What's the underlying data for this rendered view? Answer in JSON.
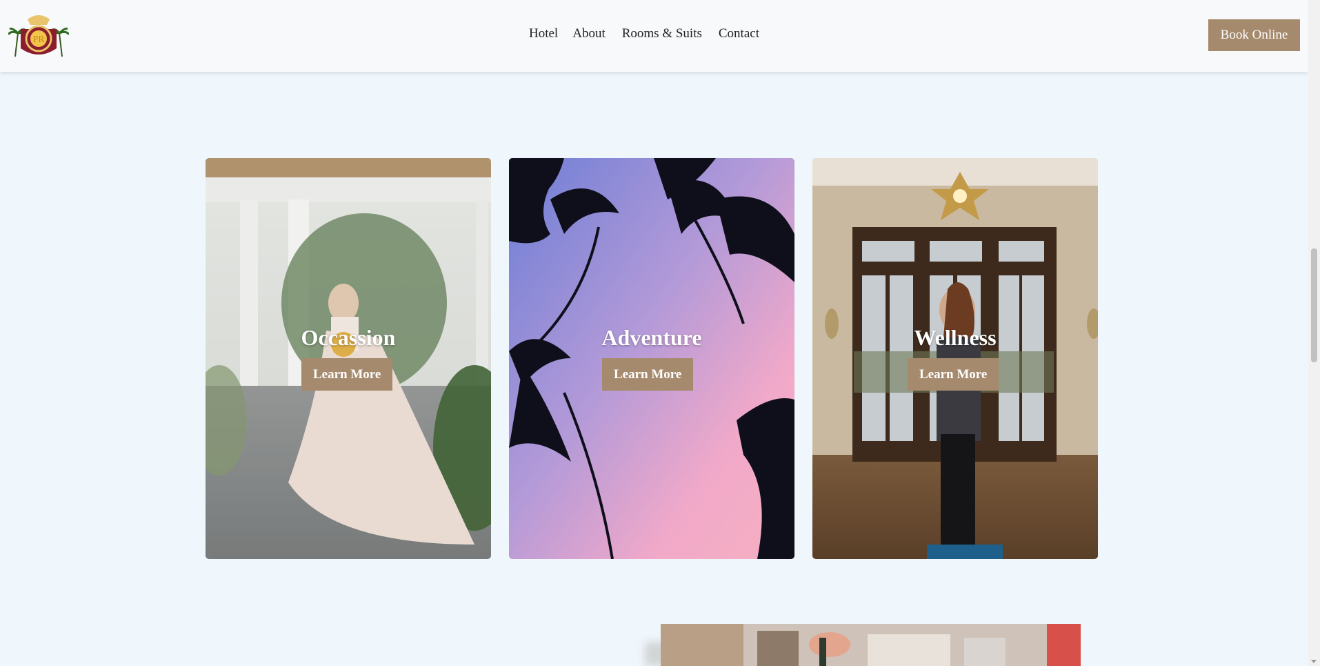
{
  "header": {
    "logo_alt": "Palm Hotel logo",
    "logo_monogram": "PR",
    "nav": [
      {
        "label": "Hotel"
      },
      {
        "label": "About"
      },
      {
        "label": "Rooms & Suits"
      },
      {
        "label": "Contact"
      }
    ],
    "book_label": "Book Online"
  },
  "cards": [
    {
      "title": "Occassion",
      "button": "Learn More"
    },
    {
      "title": "Adventure",
      "button": "Learn More"
    },
    {
      "title": "Wellness",
      "button": "Learn More"
    }
  ],
  "colors": {
    "accent": "#a68a6d",
    "page_bg": "#f0f7fc",
    "header_bg": "#f8f9fb"
  }
}
